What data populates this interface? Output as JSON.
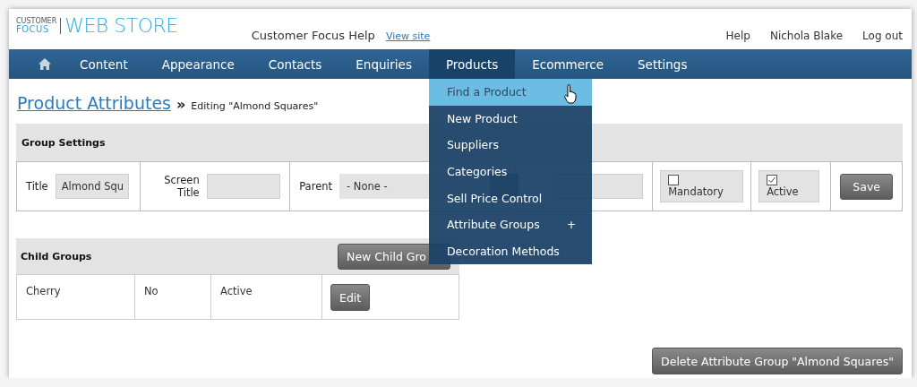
{
  "header": {
    "logo": {
      "small": "CUSTOMER",
      "brand": "FOCUS",
      "product": "WEB STORE"
    },
    "help_text": "Customer Focus Help",
    "view_site": "View site",
    "user_links": [
      "Help",
      "Nichola Blake",
      "Log out"
    ]
  },
  "nav": {
    "items": [
      {
        "kind": "home",
        "selected": false
      },
      {
        "kind": "text",
        "label": "Content",
        "selected": false
      },
      {
        "kind": "text",
        "label": "Appearance",
        "selected": false
      },
      {
        "kind": "text",
        "label": "Contacts",
        "selected": false
      },
      {
        "kind": "text",
        "label": "Enquiries",
        "selected": false
      },
      {
        "kind": "text",
        "label": "Products",
        "selected": true
      },
      {
        "kind": "text",
        "label": "Ecommerce",
        "selected": false
      },
      {
        "kind": "text",
        "label": "Settings",
        "selected": false
      }
    ]
  },
  "dropdown": {
    "items": [
      {
        "label": "Find a Product",
        "selected": true
      },
      {
        "label": "New Product",
        "selected": false
      },
      {
        "label": "Suppliers",
        "selected": false
      },
      {
        "label": "Categories",
        "selected": false
      },
      {
        "label": "Sell Price Control",
        "selected": false
      },
      {
        "label": "Attribute Groups",
        "selected": false,
        "marker": "+"
      },
      {
        "label": "Decoration Methods",
        "selected": false
      }
    ]
  },
  "page_title": {
    "link": "Product Attributes",
    "separator": "»",
    "subtitle": "Editing \"Almond Squares\""
  },
  "group_settings": {
    "heading": "Group Settings",
    "fields": [
      {
        "kind": "text",
        "label": "Title",
        "value": "Almond Squ"
      },
      {
        "kind": "text",
        "label": "Screen Title"
      },
      {
        "kind": "select",
        "label": "Parent",
        "value": "- None -"
      },
      {
        "kind": "text"
      },
      {
        "kind": "checkbox",
        "label": "Mandatory",
        "checked": false
      },
      {
        "kind": "checkbox",
        "label": "Active",
        "checked": true
      }
    ],
    "save_button": "Save"
  },
  "child_groups": {
    "heading": "Child Groups",
    "new_button": "New Child Gro",
    "rows": [
      {
        "cells": [
          "Cherry",
          "No",
          "Active"
        ],
        "action": "Edit"
      }
    ]
  },
  "delete_button": "Delete Attribute Group \"Almond Squares\""
}
